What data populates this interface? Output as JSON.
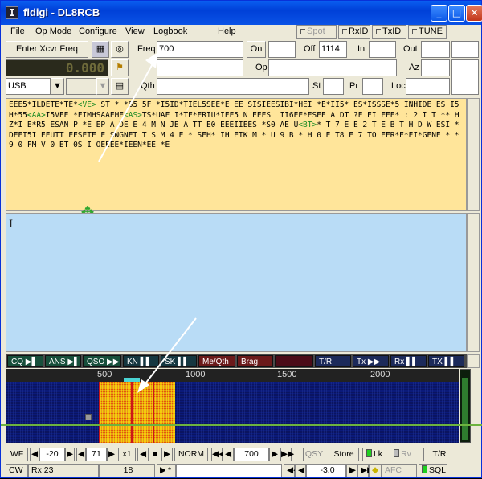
{
  "window": {
    "title": "fldigi - DL8RCB",
    "app_glyph": "I",
    "controls": {
      "minimize": "_",
      "maximize": "□",
      "close": "✕"
    }
  },
  "menu": [
    "File",
    "Op Mode",
    "Configure",
    "View",
    "Logbook",
    "Help"
  ],
  "toggles": [
    {
      "label": "Spot",
      "disabled": true
    },
    {
      "label": "RxID",
      "disabled": false
    },
    {
      "label": "TxID",
      "disabled": false
    },
    {
      "label": "TUNE",
      "disabled": false
    }
  ],
  "logbar": {
    "xcvr_button": "Enter Xcvr Freq",
    "freq_display": "0.000",
    "mode_select": "USB",
    "freq_label": "Freq",
    "freq_value": "700",
    "on_label": "On",
    "off_label": "Off",
    "off_value": "1114",
    "in_label": "In",
    "out_label": "Out",
    "call_label": "Call",
    "op_label": "Op",
    "az_label": "Az",
    "qth_label": "Qth",
    "st_label": "St",
    "pr_label": "Pr",
    "loc_label": "Loc"
  },
  "rx_text": [
    {
      "t": "EEE5*ILDETE*TE*"
    },
    {
      "t": "<VE>",
      "tag": true
    },
    {
      "t": " ST * *S5 5F *I5ID*TIEL5SEE*E EE SISIEESIBI*HEI *E*II5* ES*ISSSE*5 INHIDE ES I5 H*55"
    },
    {
      "t": "<AA>",
      "tag": true
    },
    {
      "t": "I5VEE *EIMHSAAEHE"
    },
    {
      "t": "<AS>",
      "tag": true
    },
    {
      "t": "TS*UAF I*TE*ERIU*IEE5 N EEESL II6EE*ESEE A DT ?E EI EEE* : 2 I T ** H Z*I E*R5 ESAN P *E EP A DE E 4 M N JE A TT E0 EEEIIEES *S0 AE U"
    },
    {
      "t": "<BT>",
      "tag": true
    },
    {
      "t": "* T 7 E E 2 T E B T H D W ESI *DEEI5I EEUTT EESETE E SNGNET T S M 4 E * SEH* IH EIK M * U 9 B * H 0 E T8 E 7 TO EER*E*EI*GENE * * 9 0 FM V 0 ET 0S I OEEEE*IEEN*EE *E"
    }
  ],
  "macros": [
    {
      "label": "CQ ▶▌",
      "cls": "grn"
    },
    {
      "label": "ANS ▶▌",
      "cls": "grn"
    },
    {
      "label": "QSO ▶▶",
      "cls": "grn"
    },
    {
      "label": "KN ▌▌",
      "cls": "dk"
    },
    {
      "label": "SK ▌▌",
      "cls": "dk"
    },
    {
      "label": "Me/Qth",
      "cls": "red"
    },
    {
      "label": "Brag",
      "cls": "red"
    },
    {
      "label": "",
      "cls": "mar"
    },
    {
      "label": "T/R",
      "cls": "nav"
    },
    {
      "label": "Tx ▶▶",
      "cls": "nav"
    },
    {
      "label": "Rx ▌▌",
      "cls": "nav"
    },
    {
      "label": "TX ▌▌",
      "cls": "nav"
    }
  ],
  "scale_ticks": [
    "500",
    "1000",
    "1500",
    "2000"
  ],
  "wf_controls": {
    "wf": "WF",
    "ref": "-20",
    "range": "71",
    "zoom": "x1",
    "norm": "NORM",
    "carrier": "700",
    "qsy": "QSY",
    "store": "Store",
    "lk": "Lk",
    "rv": "Rv",
    "tr": "T/R"
  },
  "status": {
    "mode": "CW",
    "rx": "Rx 23",
    "wpm": "18",
    "star": "*",
    "sql_level": "-3.0",
    "afc": "AFC",
    "sql": "SQL"
  },
  "colors": {
    "rx_bg": "#ffe59a",
    "tx_bg": "#b9dcf6",
    "tag": "#1b8a24",
    "signal": "#e89a1a"
  }
}
